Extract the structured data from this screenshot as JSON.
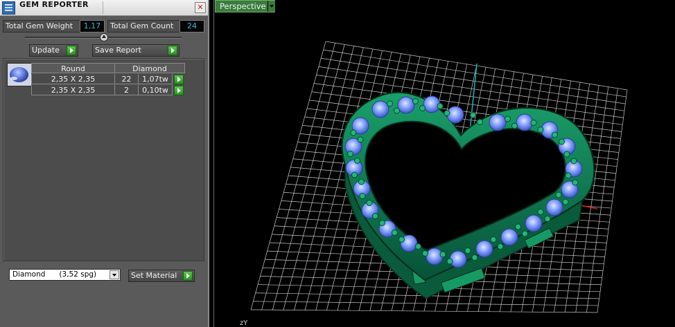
{
  "panel": {
    "title": "GEM REPORTER",
    "close_glyph": "✕",
    "total_weight_label": "Total Gem Weight",
    "total_weight_value": "1,17",
    "total_count_label": "Total Gem Count",
    "total_count_value": "24",
    "update_label": "Update",
    "save_report_label": "Save Report",
    "table": {
      "header_shape": "Round",
      "header_material": "Diamond",
      "rows": [
        {
          "size": "2,35 X 2,35",
          "count": "22",
          "weight": "1,07tw"
        },
        {
          "size": "2,35 X 2,35",
          "count": "2",
          "weight": "0,10tw"
        }
      ]
    },
    "material_select_value": "Diamond      (3,52 spg)",
    "set_material_label": "Set Material"
  },
  "viewport": {
    "view_mode": "Perspective",
    "axis_label": "zY"
  },
  "colors": {
    "panel_bg": "#5a5a5a",
    "accent_green": "#3c7a3e",
    "value_text": "#36b6d6",
    "metal": "#0c6c48",
    "gem": "#8aa6ff",
    "grid": "#c9c9c9",
    "axis_x": "#e02020",
    "axis_y": "#20a8b8"
  },
  "icons": {
    "title": "gem-reporter-icon",
    "close": "close-icon",
    "play": "play-icon",
    "dropdown": "chevron-down-icon",
    "gem_thumbnail": "round-gem-icon"
  }
}
